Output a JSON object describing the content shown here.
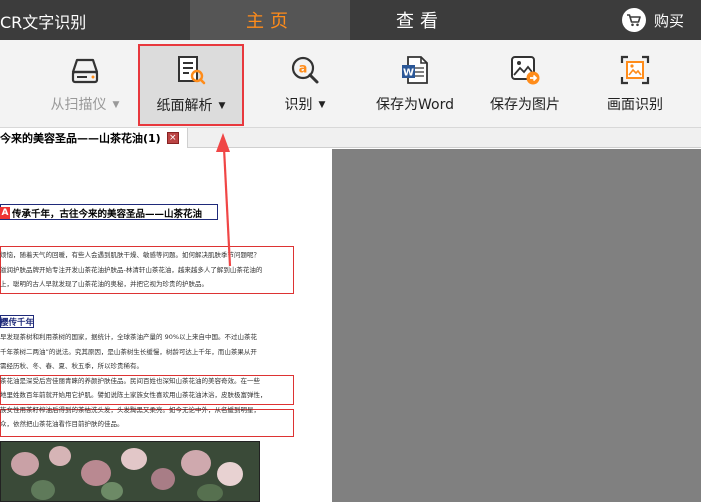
{
  "titlebar": {
    "app_title": "CR文字识别",
    "tabs": [
      {
        "label": "主页",
        "active": true
      },
      {
        "label": "查看",
        "active": false
      }
    ],
    "buy_label": "购买",
    "accent_color": "#ff8c1a"
  },
  "toolbar": {
    "items": [
      {
        "label": "从扫描仪",
        "icon": "scanner-icon",
        "has_dropdown": true,
        "disabled": true
      },
      {
        "label": "纸面解析",
        "icon": "page-analysis-icon",
        "has_dropdown": true,
        "active": true
      },
      {
        "label": "识别",
        "icon": "recognize-icon",
        "has_dropdown": true
      },
      {
        "label": "保存为Word",
        "icon": "word-icon",
        "has_dropdown": false
      },
      {
        "label": "保存为图片",
        "icon": "save-image-icon",
        "has_dropdown": false
      },
      {
        "label": "画面识别",
        "icon": "screen-capture-icon",
        "has_dropdown": false
      }
    ],
    "dropdown_arrow": "▼",
    "highlight_color": "#e8383d"
  },
  "document_tab": {
    "label": "今来的美容圣品——山茶花油(1)"
  },
  "document": {
    "heading": "传承千年，古往今来的美容圣品——山茶花油",
    "heading_badge": "A",
    "paragraph1": [
      "烦恼，随着天气的回暖，有些人会遇到肌肤干燥、敏感等问题。如何解决肌肤季节问题呢？",
      "滋润护肤品牌开始专注开发山茶花油护肤品-林清轩山茶花油，越来越多人了解到山茶花油的",
      "上，聪明的古人早就发现了山茶花油的奥秘，并把它视为珍贵的护肤品。"
    ],
    "subheading": "樱传千年",
    "paragraph2": [
      "早发现茶树和利用茶树的国家，据统计，全球茶油产量的 90%以上来自中国。不过山茶花",
      "千年茶树二两油”的说法。究其原因，是山茶树生长缓慢，树龄可达上千年，而山茶果从开",
      "需经历秋、冬、春、夏、秋五季，所以珍贵稀有。",
      "茶花油是深受后宫佳丽青睐的养颜护肤佳品。民间百姓也深知山茶花油的美容奇效。在一些",
      "地里姓数百年前就开始用它护肌。譬如说陈土家族女性喜欢用山茶花油沐浴，皮肤极富弹性，",
      "族女性用茶籽榨油后得到的茶枯洗头发，头发黝黑又柔亮。如今无论中外，从名媛到明星，",
      "众，依然把山茶花油看作目前护肤的佳品。"
    ]
  }
}
